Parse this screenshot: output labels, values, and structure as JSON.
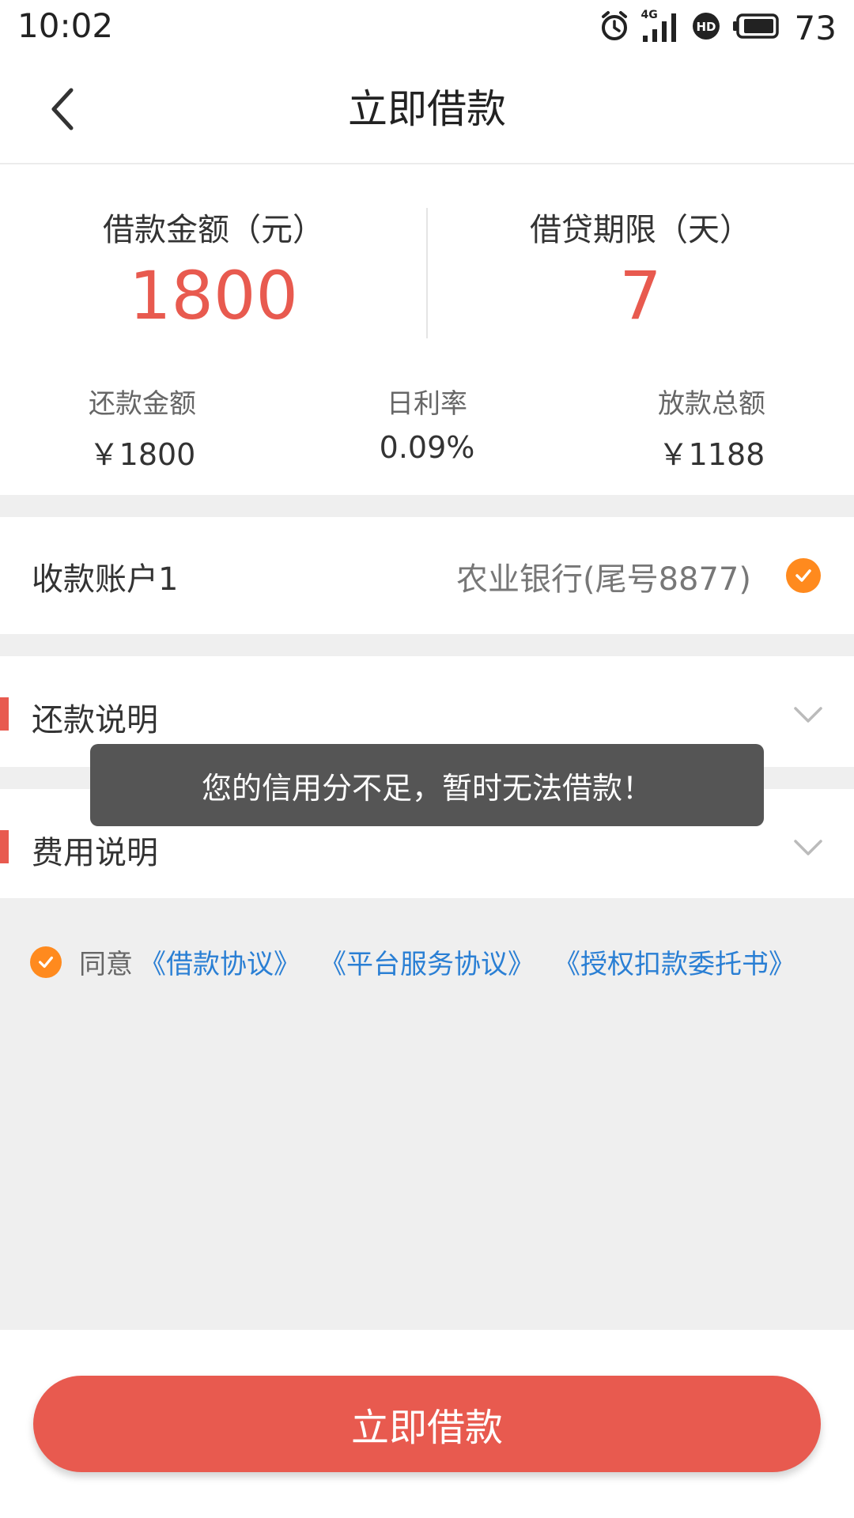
{
  "status_bar": {
    "time": "10:02",
    "network": "4G",
    "battery": "73",
    "icons": [
      "alarm-icon",
      "signal-icon",
      "hd-icon",
      "battery-icon"
    ]
  },
  "nav": {
    "back_icon": "chevron-left-icon",
    "title": "立即借款"
  },
  "summary": {
    "loan_amount_label": "借款金额（元）",
    "loan_amount": "1800",
    "loan_term_label": "借贷期限（天）",
    "loan_term": "7",
    "stats": [
      {
        "label": "还款金额",
        "value": "￥1800"
      },
      {
        "label": "日利率",
        "value": "0.09%"
      },
      {
        "label": "放款总额",
        "value": "￥1188"
      }
    ]
  },
  "account": {
    "label": "收款账户1",
    "value": "农业银行(尾号8877)",
    "selected": true
  },
  "sections": [
    {
      "title": "还款说明",
      "icon": "chevron-down-icon"
    },
    {
      "title": "费用说明",
      "icon": "chevron-down-icon"
    }
  ],
  "agreement": {
    "checked": true,
    "prefix": "同意",
    "links": [
      "《借款协议》",
      "《平台服务协议》",
      "《授权扣款委托书》"
    ]
  },
  "toast": {
    "message": "您的信用分不足，暂时无法借款！"
  },
  "submit": {
    "label": "立即借款"
  },
  "colors": {
    "accent_red": "#e85a4f",
    "check_orange": "#ff8a1e",
    "link_blue": "#2a7fd4",
    "background_gray": "#efefef",
    "toast_bg": "#555555"
  }
}
